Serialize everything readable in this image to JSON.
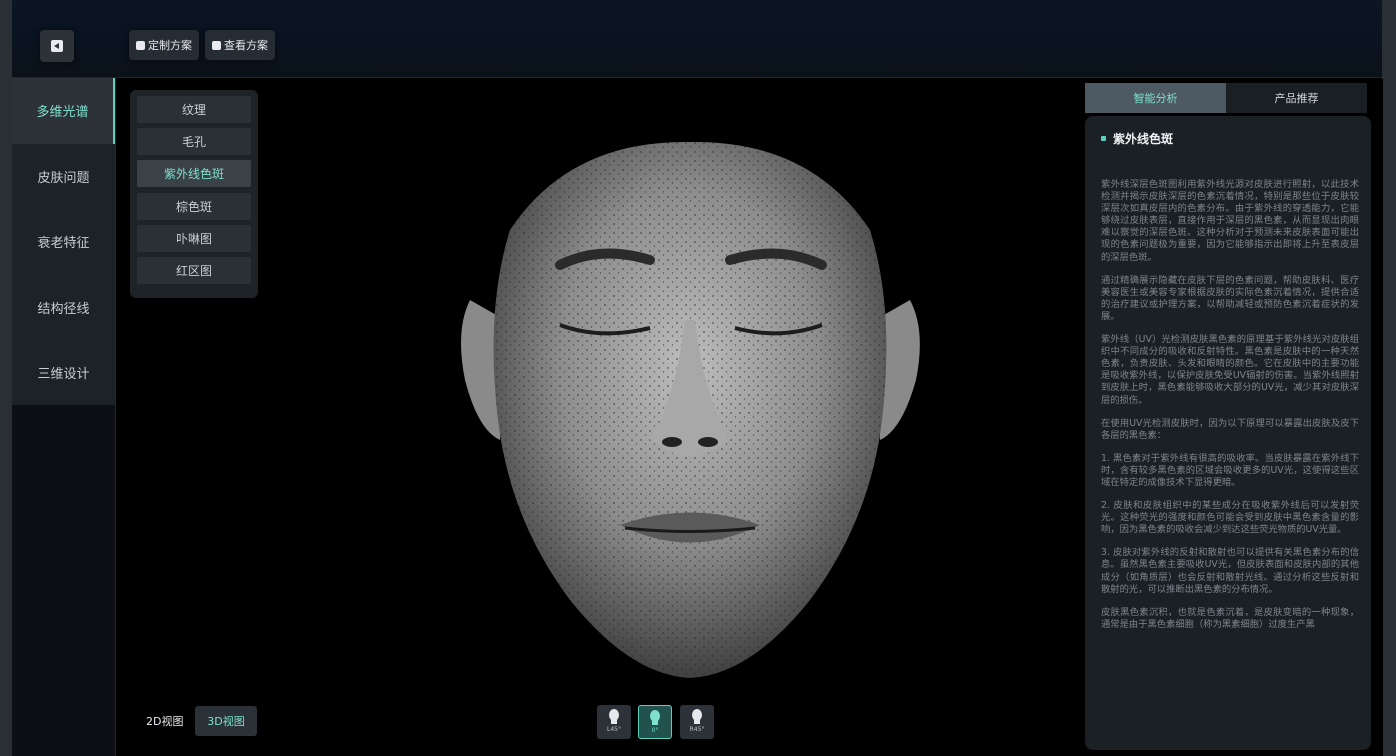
{
  "toolbar": {
    "custom_plan": "定制方案",
    "view_plan": "查看方案"
  },
  "sidenav": {
    "items": [
      {
        "label": "多维光谱"
      },
      {
        "label": "皮肤问题"
      },
      {
        "label": "衰老特征"
      },
      {
        "label": "结构径线"
      },
      {
        "label": "三维设计"
      }
    ]
  },
  "layers": {
    "items": [
      {
        "label": "纹理"
      },
      {
        "label": "毛孔"
      },
      {
        "label": "紫外线色斑"
      },
      {
        "label": "棕色斑"
      },
      {
        "label": "卟啉图"
      },
      {
        "label": "红区图"
      }
    ],
    "selected": "紫外线色斑"
  },
  "view_toggle": {
    "label_2d": "2D视图",
    "label_3d": "3D视图",
    "selected": "3D视图"
  },
  "angles": [
    {
      "label": "L45°"
    },
    {
      "label": "0°"
    },
    {
      "label": "R45°"
    }
  ],
  "right_tabs": [
    {
      "label": "智能分析"
    },
    {
      "label": "产品推荐"
    }
  ],
  "analysis": {
    "title": "紫外线色斑",
    "paragraphs": [
      "紫外线深层色斑图利用紫外线光源对皮肤进行照射，以此技术检测并揭示皮肤深层的色素沉着情况，特别是那些位于皮肤较深层次如真皮层内的色素分布。由于紫外线的穿透能力，它能够绕过皮肤表层，直接作用于深层的黑色素，从而显现出肉眼难以察觉的深层色斑。这种分析对于预测未来皮肤表面可能出现的色素问题极为重要，因为它能够指示出即将上升至表皮层的深层色斑。",
      "通过精确展示隐藏在皮肤下层的色素问题，帮助皮肤科、医疗美容医生或美容专家根据皮肤的实际色素沉着情况，提供合适的治疗建议或护理方案，以帮助减轻或预防色素沉着症状的发展。",
      "紫外线（UV）光检测皮肤黑色素的原理基于紫外线光对皮肤组织中不同成分的吸收和反射特性。黑色素是皮肤中的一种天然色素，负责皮肤、头发和眼睛的颜色。它在皮肤中的主要功能是吸收紫外线，以保护皮肤免受UV辐射的伤害。当紫外线照射到皮肤上时，黑色素能够吸收大部分的UV光，减少其对皮肤深层的损伤。",
      "在使用UV光检测皮肤时，因为以下原理可以暴露出皮肤及皮下各层的黑色素：",
      "1. 黑色素对于紫外线有很高的吸收率。当皮肤暴露在紫外线下时，含有较多黑色素的区域会吸收更多的UV光，这使得这些区域在特定的成像技术下显得更暗。",
      "2. 皮肤和皮肤组织中的某些成分在吸收紫外线后可以发射荧光。这种荧光的强度和颜色可能会受到皮肤中黑色素含量的影响，因为黑色素的吸收会减少到达这些荧光物质的UV光量。",
      "3. 皮肤对紫外线的反射和散射也可以提供有关黑色素分布的信息。虽然黑色素主要吸收UV光，但皮肤表面和皮肤内部的其他成分（如角质层）也会反射和散射光线。通过分析这些反射和散射的光，可以推断出黑色素的分布情况。",
      "皮肤黑色素沉积，也就是色素沉着，是皮肤变暗的一种现象，通常是由于黑色素细胞（称为黑素细胞）过度生产黑"
    ]
  }
}
